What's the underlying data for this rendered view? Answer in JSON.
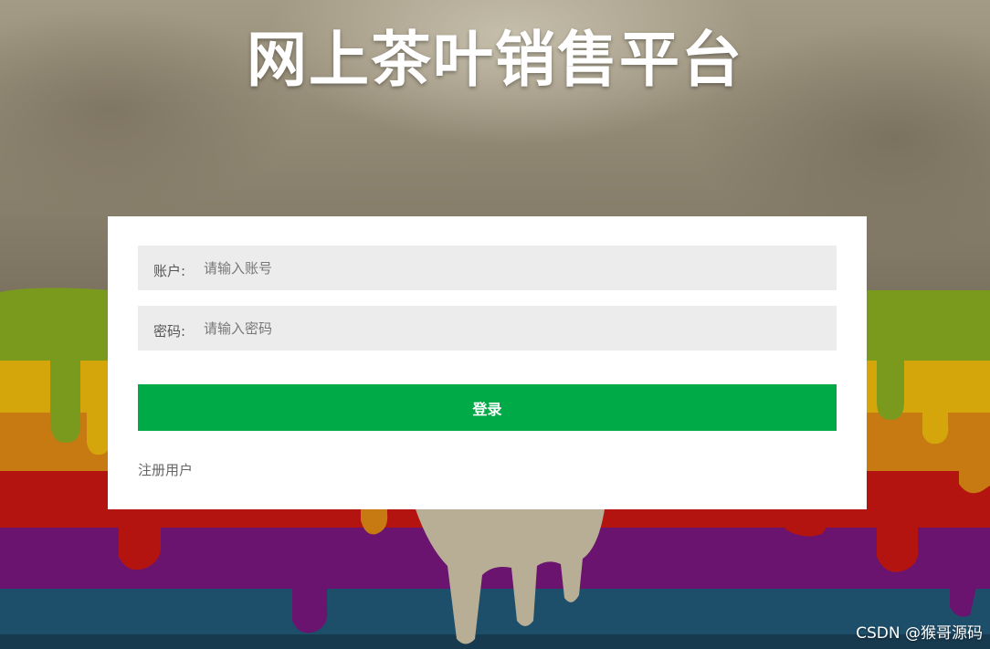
{
  "page": {
    "title": "网上茶叶销售平台"
  },
  "login_form": {
    "account_label": "账户:",
    "account_placeholder": "请输入账号",
    "password_label": "密码:",
    "password_placeholder": "请输入密码",
    "login_button": "登录",
    "register_link": "注册用户"
  },
  "watermark": {
    "text": "CSDN @猴哥源码"
  },
  "colors": {
    "login_button": "#00aa47",
    "field_background": "#ececec",
    "card_background": "#ffffff",
    "paint_green": "#7a9a1e",
    "paint_yellow": "#d4a60c",
    "paint_orange": "#c77a12",
    "paint_red": "#b3140f",
    "paint_purple": "#6a1470",
    "paint_blue": "#1d4f6b"
  }
}
